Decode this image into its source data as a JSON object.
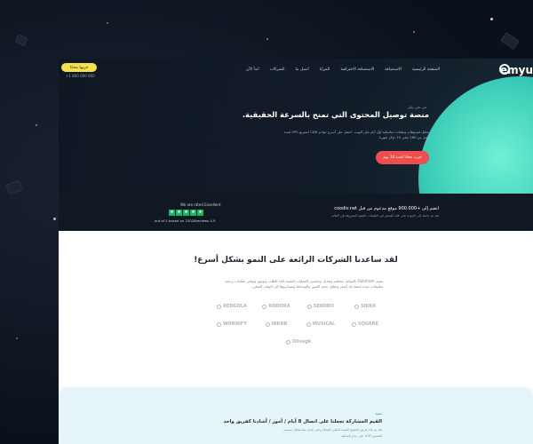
{
  "nav": {
    "logo": "emyu",
    "links": [
      "الصفحة الرئيسية",
      "الاستضافة",
      "الاستضافة الاحترافية",
      "المزايا",
      "اتصل بنا",
      "الشركات",
      "ابدأ الآن"
    ],
    "cta": "جربها مجانا",
    "phone": "+1 800 000 000"
  },
  "hero": {
    "eyebrow": "من نحن بيان",
    "headline": "منصة توصيل المحتوى التي تمنح بالسرعة الحقيقية.",
    "description": "تحليل فيديوهات وملفات ديناميكية أول أيام على الويب. احصل على أسرع خوادم CDN لتسريع VPS لمدة تصل من 180 ميلي 15 دولار شهريا.",
    "button": "جرب مجانا لمدة 14 يوم"
  },
  "proof": {
    "title": "انضم إلى +900.000 موقع مدعوم من قبل coodiv.net",
    "subtitle": "لقد تم عاملة إلى الجودة على قلة الفحص في الطبقات الخفية المعروفة في العالم",
    "rated": "We are rated Excellent",
    "stars": [
      "★",
      "★",
      "★",
      "★",
      "★"
    ],
    "meta": "out of 5 based on 25026reviews 4.9"
  },
  "clients": {
    "title": "لقد ساعدنا الشركات الرائعة على النمو بشكل أسرع!",
    "description": "يقوم Optimizer بالتوكيل بتعظيم وتعديل وتحسين العمليات التقنية أثناء الطلب وتوثيق وتوفير عمليات برمجة تطبيقات جيدة لمشاركة أصغر وتقليل حجم الصور والوسائط وسيناريوها إلى الوقت الفعلي.",
    "brands": [
      "SIKKA",
      "SEKORO",
      "KODORA",
      "REDGOLA",
      "SQUARE",
      "MUSICAL",
      "INKNR",
      "WORNIFY"
    ],
    "last_brand": "Olivegk"
  },
  "feature": {
    "badge": "نشط",
    "title": "القيم المشاركة تجعلنا على اتصال 8 أيام / أمور / أشادنا كفريق واحد",
    "lines": [
      "لقد تم بناء بغرض لتحقيق القيمة المثلى للعملاء ونحن نعمل معا بشكل مستمر",
      "لتحسين الأداء على مدار الساعة"
    ]
  }
}
